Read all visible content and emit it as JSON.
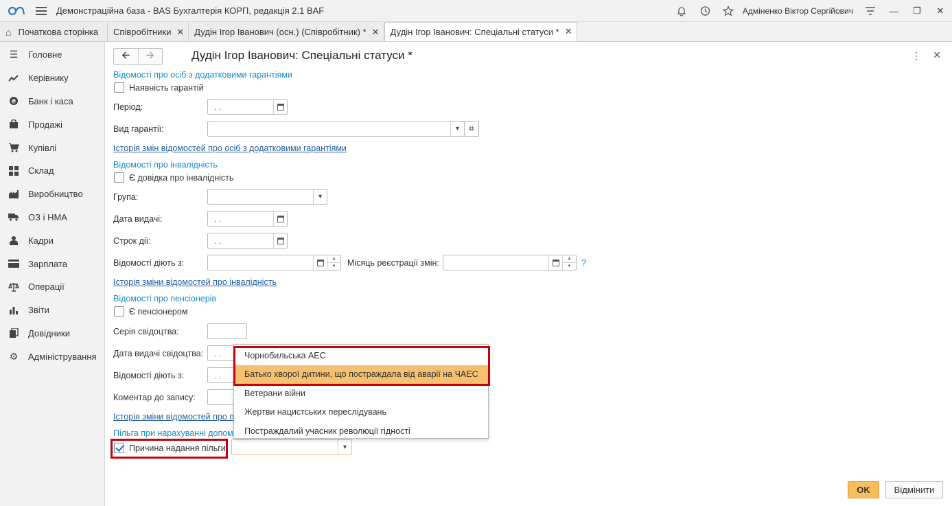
{
  "app": {
    "title": "Демонстраційна база - BAS Бухгалтерія КОРП, редакція 2.1 BAF",
    "user": "Адміненко Віктор Сергійович"
  },
  "tabs": [
    {
      "label": "Початкова сторінка"
    },
    {
      "label": "Співробітники"
    },
    {
      "label": "Дудін Ігор Іванович (осн.) (Співробітник) *"
    },
    {
      "label": "Дудін Ігор Іванович: Спеціальні статуси *"
    }
  ],
  "sidebar": {
    "items": [
      {
        "label": "Головне",
        "icon": "list-icon"
      },
      {
        "label": "Керівнику",
        "icon": "trend-icon"
      },
      {
        "label": "Банк і каса",
        "icon": "coin-icon"
      },
      {
        "label": "Продажі",
        "icon": "bag-icon"
      },
      {
        "label": "Купівлі",
        "icon": "cart-icon"
      },
      {
        "label": "Склад",
        "icon": "grid-icon"
      },
      {
        "label": "Виробництво",
        "icon": "factory-icon"
      },
      {
        "label": "ОЗ і НМА",
        "icon": "truck-icon"
      },
      {
        "label": "Кадри",
        "icon": "person-icon"
      },
      {
        "label": "Зарплата",
        "icon": "card-icon"
      },
      {
        "label": "Операції",
        "icon": "scales-icon"
      },
      {
        "label": "Звіти",
        "icon": "bar-chart-icon"
      },
      {
        "label": "Довідники",
        "icon": "books-icon"
      },
      {
        "label": "Адміністрування",
        "icon": "gear-icon"
      }
    ]
  },
  "form": {
    "title": "Дудін Ігор Іванович: Спеціальні статуси *",
    "guarantees": {
      "section": "Відомості про осіб з додатковими гарантіями",
      "checkbox": "Наявність гарантій",
      "period_label": "Період:",
      "period_value": ". .",
      "type_label": "Вид гарантії:",
      "history_link": "Історія змін відомостей про осіб з додатковими гарантіями"
    },
    "disability": {
      "section": "Відомості про інвалідність",
      "checkbox": "Є довідка про інвалідність",
      "group_label": "Група:",
      "issue_date_label": "Дата видачі:",
      "issue_date_value": ". .",
      "validity_label": "Строк дії:",
      "validity_value": ". .",
      "effective_label": "Відомості діють з:",
      "reg_month_label": "Місяць реєстрації змін:",
      "help": "?",
      "history_link": "Історія зміни відомостей про інвалідність"
    },
    "pensioner": {
      "section": "Відомості про пенсіонерів",
      "checkbox": "Є пенсіонером",
      "cert_series_label": "Серія свідоцтва:",
      "cert_date_label": "Дата видачі свідоцтва:",
      "cert_date_value": ". .",
      "effective_label": "Відомості діють з:",
      "effective_value": ". .",
      "comment_label": "Коментар до запису:",
      "history_link": "Історія зміни відомостей про п"
    },
    "benefit": {
      "section": "Пільга при нарахуванні допом",
      "checkbox": "Причина надання пільги"
    },
    "dropdown_options": [
      "Чорнобильська АЕС",
      "Батько хворої дитини, що постраждала від аварії на ЧАЕС",
      "Ветерани війни",
      "Жертви нацистських переслідувань",
      "Постраждалий учасник революції гідності"
    ],
    "selected_option_index": 1,
    "ok": "OK",
    "cancel": "Відмінити"
  },
  "colors": {
    "accent": "#1a8bc9",
    "ok_button": "#f7bd5f",
    "selected_row": "#f5c06f",
    "highlight": "#c8000a"
  }
}
